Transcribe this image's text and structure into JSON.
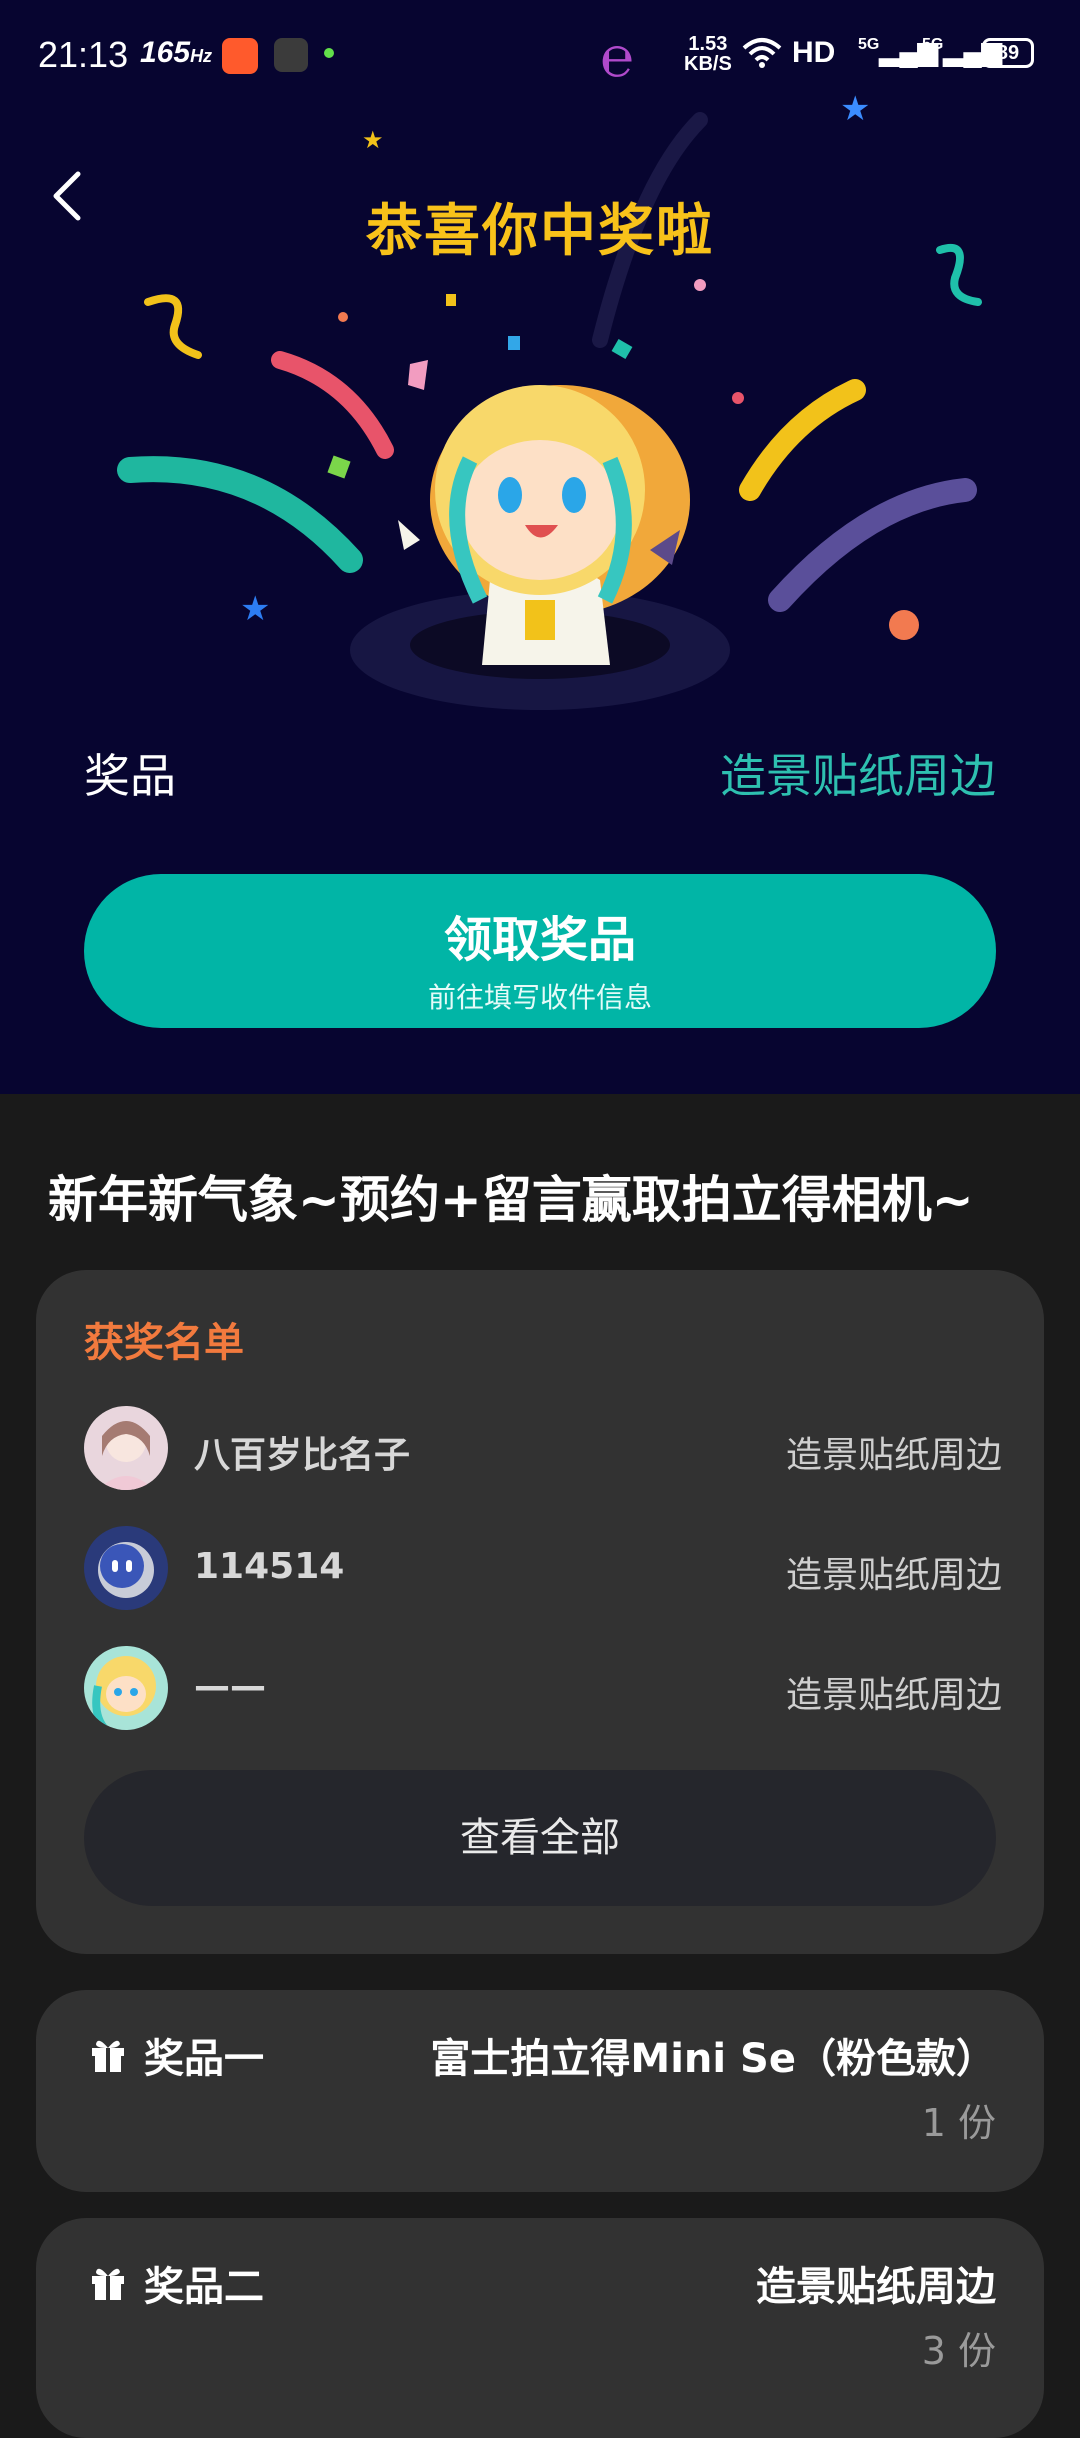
{
  "status_bar": {
    "time": "21:13",
    "refresh_rate": "165",
    "refresh_unit": "Hz",
    "net_speed_value": "1.53",
    "net_speed_unit": "KB/S",
    "hd": "HD",
    "signal1": "5G",
    "signal2": "5G",
    "battery": "89"
  },
  "hero": {
    "title": "恭喜你中奖啦",
    "prize_label": "奖品",
    "prize_value": "造景贴纸周边",
    "claim_button": "领取奖品",
    "claim_subtitle": "前往填写收件信息",
    "colors": {
      "accent": "#01b5a6",
      "title": "#f8c21a",
      "background": "#070530"
    }
  },
  "event": {
    "title": "新年新气象~预约+留言赢取拍立得相机~"
  },
  "winners": {
    "heading": "获奖名单",
    "rows": [
      {
        "name": "八百岁比名子",
        "prize": "造景贴纸周边"
      },
      {
        "name": "114514",
        "prize": "造景贴纸周边"
      },
      {
        "name": "——",
        "prize": "造景贴纸周边"
      }
    ],
    "view_all": "查看全部"
  },
  "prizes": [
    {
      "name": "奖品一",
      "item": "富士拍立得Mini Se（粉色款）",
      "qty": "1 份"
    },
    {
      "name": "奖品二",
      "item": "造景贴纸周边",
      "qty": "3 份"
    }
  ]
}
